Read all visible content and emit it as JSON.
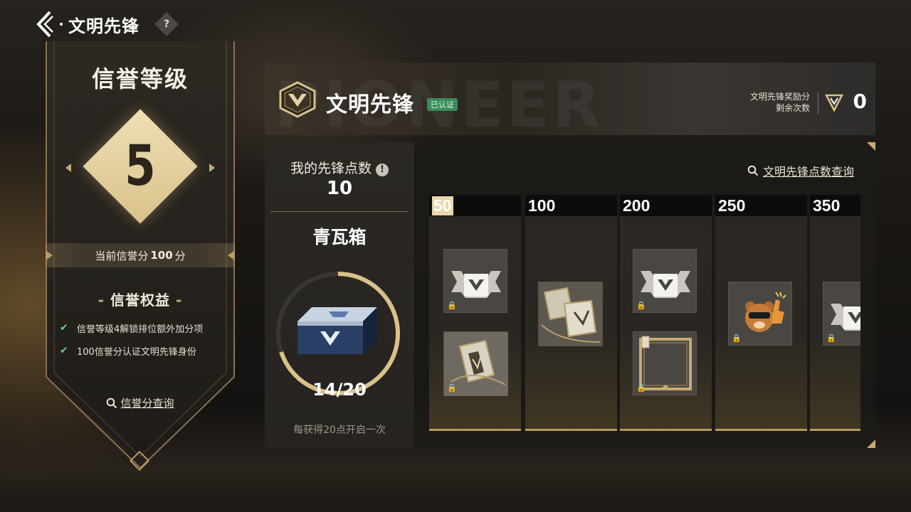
{
  "header": {
    "page_title": "文明先锋",
    "help_label": "?"
  },
  "rank": {
    "title": "信誉等级",
    "level": "5",
    "score_prefix": "当前信誉分",
    "score_value": "100",
    "score_unit": "分",
    "benefits_title": "信誉权益",
    "benefits": [
      "信誉等级4解锁排位额外加分项",
      "100信誉分认证文明先锋身份"
    ],
    "query_label": "信誉分查询"
  },
  "pioneer": {
    "watermark": "PIONEER",
    "title": "文明先锋",
    "verified_badge": "已认证",
    "reward_label_line1": "文明先锋奖励分",
    "reward_label_line2": "剩余次数",
    "reward_count": "0",
    "points_label": "我的先锋点数",
    "info_icon": "!",
    "points_value": "10",
    "box_name": "青瓦箱",
    "box_progress_text": "14/20",
    "box_progress": 0.7,
    "box_hint": "每获得20点开启一次",
    "query_label": "文明先锋点数查询",
    "tiers": [
      {
        "label": "50",
        "reached": true
      },
      {
        "label": "100",
        "reached": false
      },
      {
        "label": "200",
        "reached": false
      },
      {
        "label": "250",
        "reached": false
      },
      {
        "label": "350",
        "reached": false
      }
    ]
  },
  "icons": {
    "back": "chevron-left-icon",
    "help": "question-icon",
    "check": "check-icon",
    "search": "search-icon",
    "lock": "lock-icon"
  },
  "colors": {
    "accent_gold": "#d9c18a",
    "verified_green": "#3a8c5a",
    "check_green": "#6fd18a"
  }
}
